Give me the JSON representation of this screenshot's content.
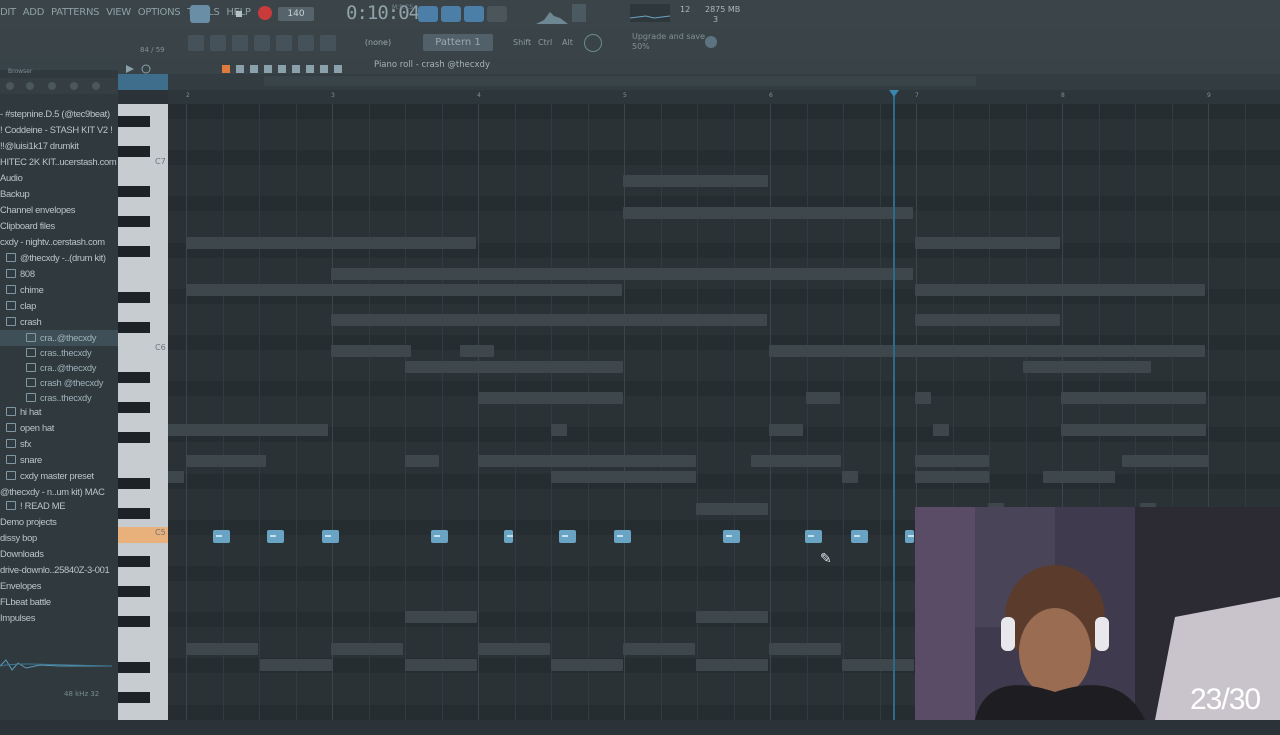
{
  "menu": [
    "DIT",
    "ADD",
    "PATTERNS",
    "VIEW",
    "OPTIONS",
    "TOOLS",
    "HELP"
  ],
  "transport": {
    "tempo": "140",
    "time": "0:10:04",
    "time_ms": "M:S:CS"
  },
  "performance": {
    "cpu": "12",
    "memory": "2875 MB",
    "polyphony": "3"
  },
  "toolbar": {
    "channel_select": "(none)",
    "pattern": "Pattern 1",
    "mod_shift": "Shift",
    "mod_ctrl": "Ctrl",
    "mod_alt": "Alt",
    "upgrade_line1": "Upgrade and save",
    "upgrade_line2": "50%"
  },
  "browser": {
    "title": "Browser",
    "count": "84 / 59",
    "items": [
      "- #stepnine.D.5 (@tec9beat)",
      "! Coddeine - STASH KIT V2 !",
      "!!@luisi1k17 drumkit",
      "HITEC 2K KIT..ucerstash.com",
      "Audio",
      "Backup",
      "Channel envelopes",
      "Clipboard files",
      "cxdy - nightv..cerstash.com",
      "@thecxdy -..(drum kit)",
      "808",
      "chime",
      "clap",
      "crash",
      "cra..@thecxdy",
      "cras..thecxdy",
      "cra..@thecxdy",
      "crash @thecxdy",
      "cras..thecxdy",
      "hi hat",
      "open hat",
      "sfx",
      "snare",
      "cxdy master preset",
      "@thecxdy - n..um kit) MAC",
      "! READ ME",
      "Demo projects",
      "dissy bop",
      "Downloads",
      "drive-downlo..25840Z-3-001",
      "Envelopes",
      "FLbeat battle",
      "Impulses"
    ],
    "sample_rate": "48 kHz 32"
  },
  "piano_roll": {
    "title": "Piano roll - crash @thecxdy",
    "bar_numbers": [
      "2",
      "3",
      "4",
      "5",
      "6",
      "7",
      "8",
      "9"
    ],
    "key_labels": [
      "C7",
      "C6",
      "C5"
    ]
  },
  "overlay": {
    "counter": "23/30"
  }
}
